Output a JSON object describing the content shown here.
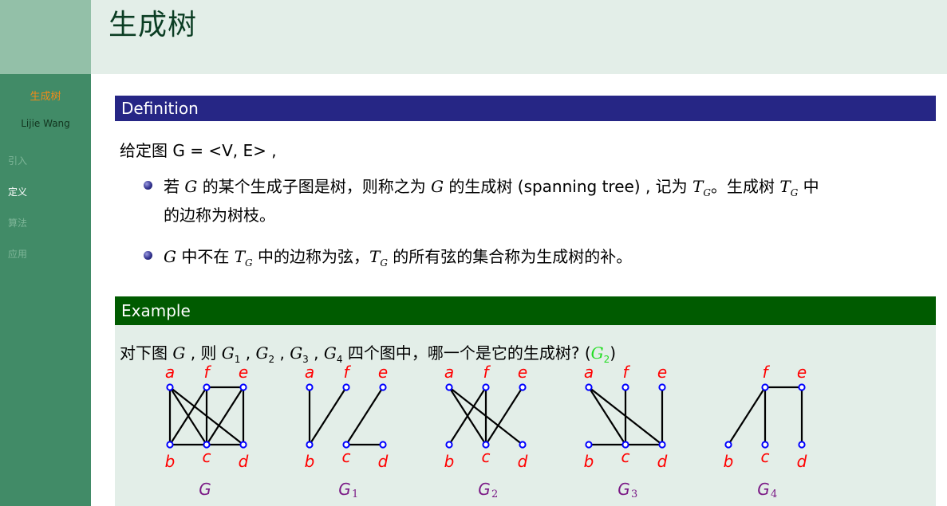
{
  "header": {
    "title": "生成树"
  },
  "sidebar": {
    "title": "生成树",
    "author": "Lijie Wang",
    "items": [
      {
        "label": "引入",
        "active": false
      },
      {
        "label": "定义",
        "active": true
      },
      {
        "label": "算法",
        "active": false
      },
      {
        "label": "应用",
        "active": false
      }
    ]
  },
  "definition": {
    "heading": "Definition",
    "intro": "给定图 G = <V, E> ,",
    "bullet1": {
      "p1": "若 ",
      "g1": "G",
      "p2": " 的某个生成子图是树，则称之为 ",
      "g2": "G",
      "p3": " 的生成树 (spanning tree) , 记为 ",
      "t1": "T",
      "t1sub": "G",
      "p4": "。生成树 ",
      "t2": "T",
      "t2sub": "G",
      "p5": " 中",
      "line2": "的边称为树枝。"
    },
    "bullet2": {
      "g": "G",
      "p1": " 中不在 ",
      "t1": "T",
      "t1sub": "G",
      "p2": " 中的边称为弦，",
      "t2": "T",
      "t2sub": "G",
      "p3": " 的所有弦的集合称为生成树的补。"
    }
  },
  "example": {
    "heading": "Example",
    "question": {
      "p1": "对下图 ",
      "g": "G",
      "p2": " , 则 ",
      "g1": "G",
      "g1sub": "1",
      "sep1": " , ",
      "g2": "G",
      "g2sub": "2",
      "sep2": " , ",
      "g3": "G",
      "g3sub": "3",
      "sep3": " , ",
      "g4": "G",
      "g4sub": "4",
      "p3": " 四个图中，哪一个是它的生成树? (",
      "ans": "G",
      "anssub": "2",
      "p4": ")"
    },
    "colors": {
      "vertex": "#0000ff",
      "vertex_label": "#ff0000",
      "edge": "#000000",
      "graph_label": "#7b1a86",
      "answer": "#22dd22"
    },
    "graphs": [
      {
        "name": "G",
        "sub": "",
        "vertices": [
          "a",
          "f",
          "e",
          "b",
          "c",
          "d"
        ],
        "edges": [
          [
            "a",
            "b"
          ],
          [
            "a",
            "c"
          ],
          [
            "a",
            "d"
          ],
          [
            "f",
            "e"
          ],
          [
            "f",
            "b"
          ],
          [
            "f",
            "c"
          ],
          [
            "e",
            "c"
          ],
          [
            "e",
            "d"
          ],
          [
            "b",
            "c"
          ],
          [
            "c",
            "d"
          ]
        ]
      },
      {
        "name": "G",
        "sub": "1",
        "vertices": [
          "a",
          "f",
          "e",
          "b",
          "c",
          "d"
        ],
        "edges": [
          [
            "a",
            "b"
          ],
          [
            "f",
            "b"
          ],
          [
            "e",
            "c"
          ],
          [
            "c",
            "d"
          ]
        ]
      },
      {
        "name": "G",
        "sub": "2",
        "vertices": [
          "a",
          "f",
          "e",
          "b",
          "c",
          "d"
        ],
        "edges": [
          [
            "a",
            "c"
          ],
          [
            "a",
            "d"
          ],
          [
            "f",
            "b"
          ],
          [
            "f",
            "c"
          ],
          [
            "e",
            "c"
          ]
        ]
      },
      {
        "name": "G",
        "sub": "3",
        "vertices": [
          "a",
          "f",
          "e",
          "b",
          "c",
          "d"
        ],
        "edges": [
          [
            "a",
            "c"
          ],
          [
            "a",
            "d"
          ],
          [
            "f",
            "c"
          ],
          [
            "e",
            "d"
          ],
          [
            "b",
            "c"
          ],
          [
            "c",
            "d"
          ]
        ]
      },
      {
        "name": "G",
        "sub": "4",
        "vertices": [
          "f",
          "e",
          "b",
          "c",
          "d"
        ],
        "edges": [
          [
            "f",
            "e"
          ],
          [
            "f",
            "b"
          ],
          [
            "f",
            "c"
          ],
          [
            "e",
            "d"
          ]
        ]
      }
    ]
  }
}
